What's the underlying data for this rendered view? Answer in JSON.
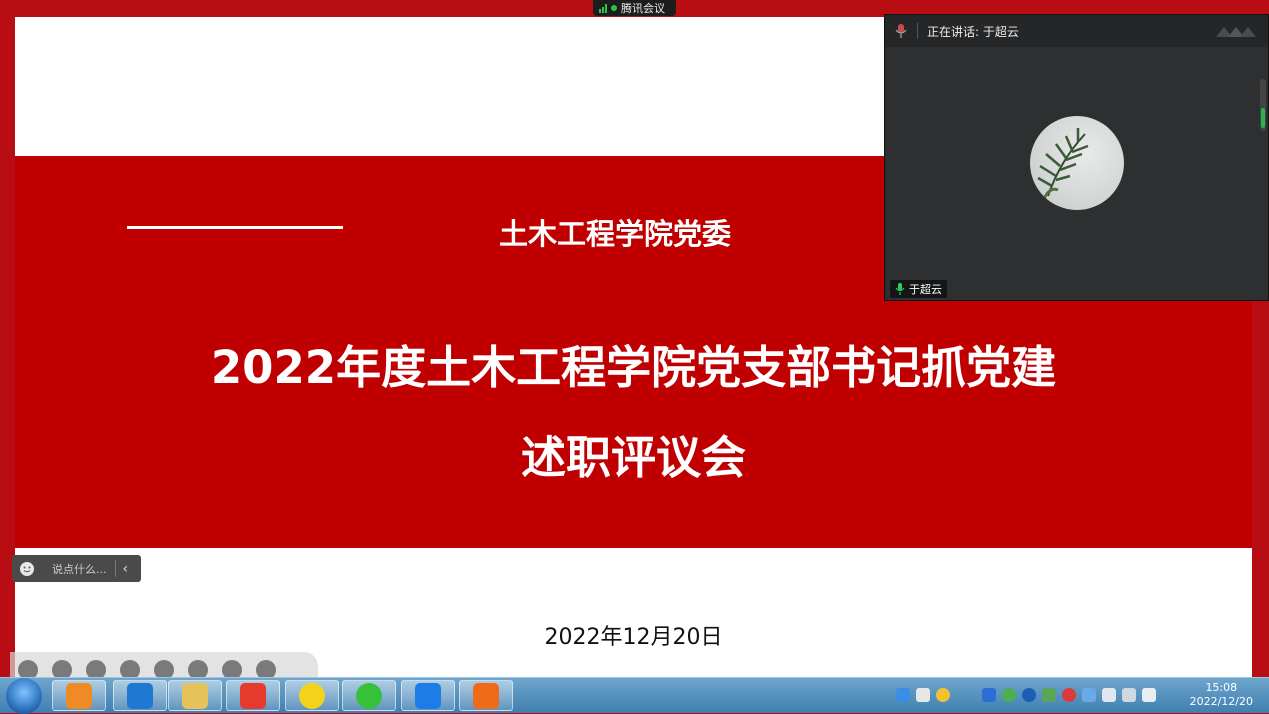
{
  "slide": {
    "org": "土木工程学院党委",
    "title_line1": "2022年度土木工程学院党支部书记抓党建",
    "title_line2": "述职评议会",
    "date": "2022年12月20日"
  },
  "meeting_tab": {
    "label": "腾讯会议"
  },
  "video": {
    "speaking_label": "正在讲话: 于超云",
    "participant_name": "于超云"
  },
  "chat": {
    "placeholder": "说点什么..."
  },
  "clock": {
    "time": "15:08",
    "date": "2022/12/20"
  },
  "colors": {
    "slide_red": "#c00000",
    "frame_red": "#b80d12",
    "meeting_green": "#28c840"
  },
  "taskbar_apps": [
    "uc-browser-icon",
    "windows-explorer-icon",
    "file-manager-icon",
    "wps-office-icon",
    "qq-music-icon",
    "wechat-icon",
    "tencent-meeting-icon",
    "media-player-icon"
  ]
}
